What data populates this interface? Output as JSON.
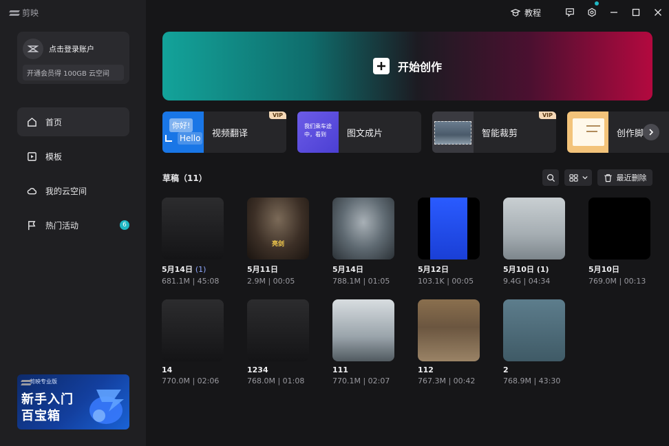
{
  "app": {
    "name": "剪映"
  },
  "sidebar": {
    "login": {
      "label": "点击登录账户",
      "vip_promo": "开通会员得 100GB 云空间"
    },
    "nav": [
      {
        "label": "首页",
        "icon": "home-icon",
        "active": true
      },
      {
        "label": "模板",
        "icon": "template-icon"
      },
      {
        "label": "我的云空间",
        "icon": "cloud-icon"
      },
      {
        "label": "热门活动",
        "icon": "flag-icon",
        "badge": "6"
      }
    ],
    "promo": {
      "brand": "剪映专业版",
      "line1": "新手入门",
      "line2": "百宝箱"
    }
  },
  "topbar": {
    "tutorial_label": "教程",
    "icons": [
      "feedback-icon",
      "settings-icon"
    ],
    "window_controls": [
      "minimize-icon",
      "maximize-icon",
      "close-icon"
    ]
  },
  "create": {
    "label": "开始创作"
  },
  "tools": [
    {
      "label": "视频翻译",
      "vip": "VIP",
      "thumb": {
        "text1": "你好!",
        "text2": "Hello"
      }
    },
    {
      "label": "图文成片",
      "thumb": {
        "text": "我们乘车途中，看到"
      }
    },
    {
      "label": "智能裁剪",
      "vip": "VIP"
    },
    {
      "label": "创作脚本"
    }
  ],
  "drafts": {
    "title": "草稿（11）",
    "recent_delete_label": "最近删除",
    "items": [
      {
        "name": "5月14日",
        "count": "(1)",
        "meta": "681.1M | 45:08",
        "thumb": "dark"
      },
      {
        "name": "5月11日",
        "meta": "2.9M | 00:05",
        "thumb": "soldier"
      },
      {
        "name": "5月14日",
        "meta": "788.1M | 01:05",
        "thumb": "soldier2"
      },
      {
        "name": "5月12日",
        "meta": "103.1K | 00:05",
        "thumb": "blue"
      },
      {
        "name": "5月10日",
        "count": "(1)",
        "meta": "9.4G | 04:34",
        "thumb": "sketch"
      },
      {
        "name": "5月10日",
        "meta": "769.0M | 00:13",
        "thumb": "black"
      },
      {
        "name": "14",
        "meta": "770.0M | 02:06",
        "thumb": "dark"
      },
      {
        "name": "1234",
        "meta": "768.0M | 01:08",
        "thumb": "dark"
      },
      {
        "name": "111",
        "meta": "770.1M | 02:07",
        "thumb": "binoc"
      },
      {
        "name": "112",
        "meta": "767.3M | 00:42",
        "thumb": "sepia"
      },
      {
        "name": "2",
        "meta": "768.9M | 43:30",
        "thumb": "cartoon"
      }
    ]
  },
  "colors": {
    "accent": "#1fb7c3",
    "vip_tag": "#f5d9b8",
    "background": "#161618",
    "sidebar": "#1f1f22"
  }
}
